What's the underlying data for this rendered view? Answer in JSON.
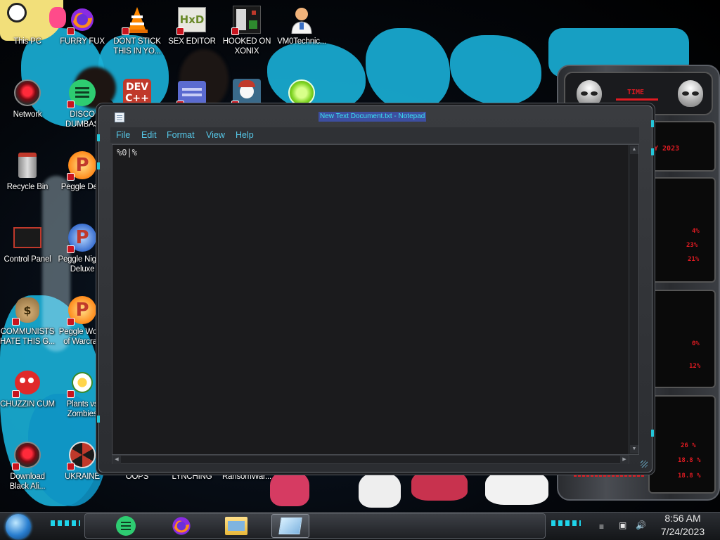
{
  "desktop": {
    "icons": [
      {
        "label": "This PC"
      },
      {
        "label": "FURRY FUX"
      },
      {
        "label": "DONT STICK THIS IN YO..."
      },
      {
        "label": "SEX EDITOR"
      },
      {
        "label": "HOOKED ON XONIX"
      },
      {
        "label": "VM0Technic..."
      },
      {
        "label": "Network"
      },
      {
        "label": "DISCO DUMBAS"
      },
      {
        "label": "Recycle Bin"
      },
      {
        "label": "Peggle Delu"
      },
      {
        "label": "Control Panel"
      },
      {
        "label": "Peggle Nights Deluxe"
      },
      {
        "label": "COMMUNISTS HATE THIS G..."
      },
      {
        "label": "Peggle World of Warcraft"
      },
      {
        "label": "CHUZZIN CUM"
      },
      {
        "label": "Plants vs Zombies"
      },
      {
        "label": "Download Black Ali..."
      },
      {
        "label": "UKRAINE"
      },
      {
        "label": "OOPS"
      },
      {
        "label": "LYNCHING"
      },
      {
        "label": "RansomWar..."
      }
    ],
    "partial_icons": [
      {
        "label": "DEV C++"
      }
    ]
  },
  "notepad": {
    "title": "New Text Document.txt - Notepad",
    "menu": [
      "File",
      "Edit",
      "Format",
      "View",
      "Help"
    ],
    "content": "%0|%"
  },
  "widget": {
    "header_label": "TIME",
    "date_fragment": "Y 2023",
    "stat1": "4%",
    "stat2": "23%",
    "stat3": "21%",
    "stat4": "0%",
    "stat5": "12%",
    "stat6": "26 %",
    "stat7": "18.8 %",
    "stat8": "18.8 %"
  },
  "taskbar": {
    "clock_time": "8:56 AM",
    "clock_date": "7/24/2023",
    "pinned": [
      "notes-app-icon",
      "firefox-icon",
      "file-explorer-icon",
      "notepad-icon"
    ]
  },
  "colors": {
    "accent_cyan": "#1fd4ea",
    "wallpaper_teal": "#1ab0d8",
    "menu_text": "#56c8e8",
    "widget_red": "#e11b22"
  }
}
